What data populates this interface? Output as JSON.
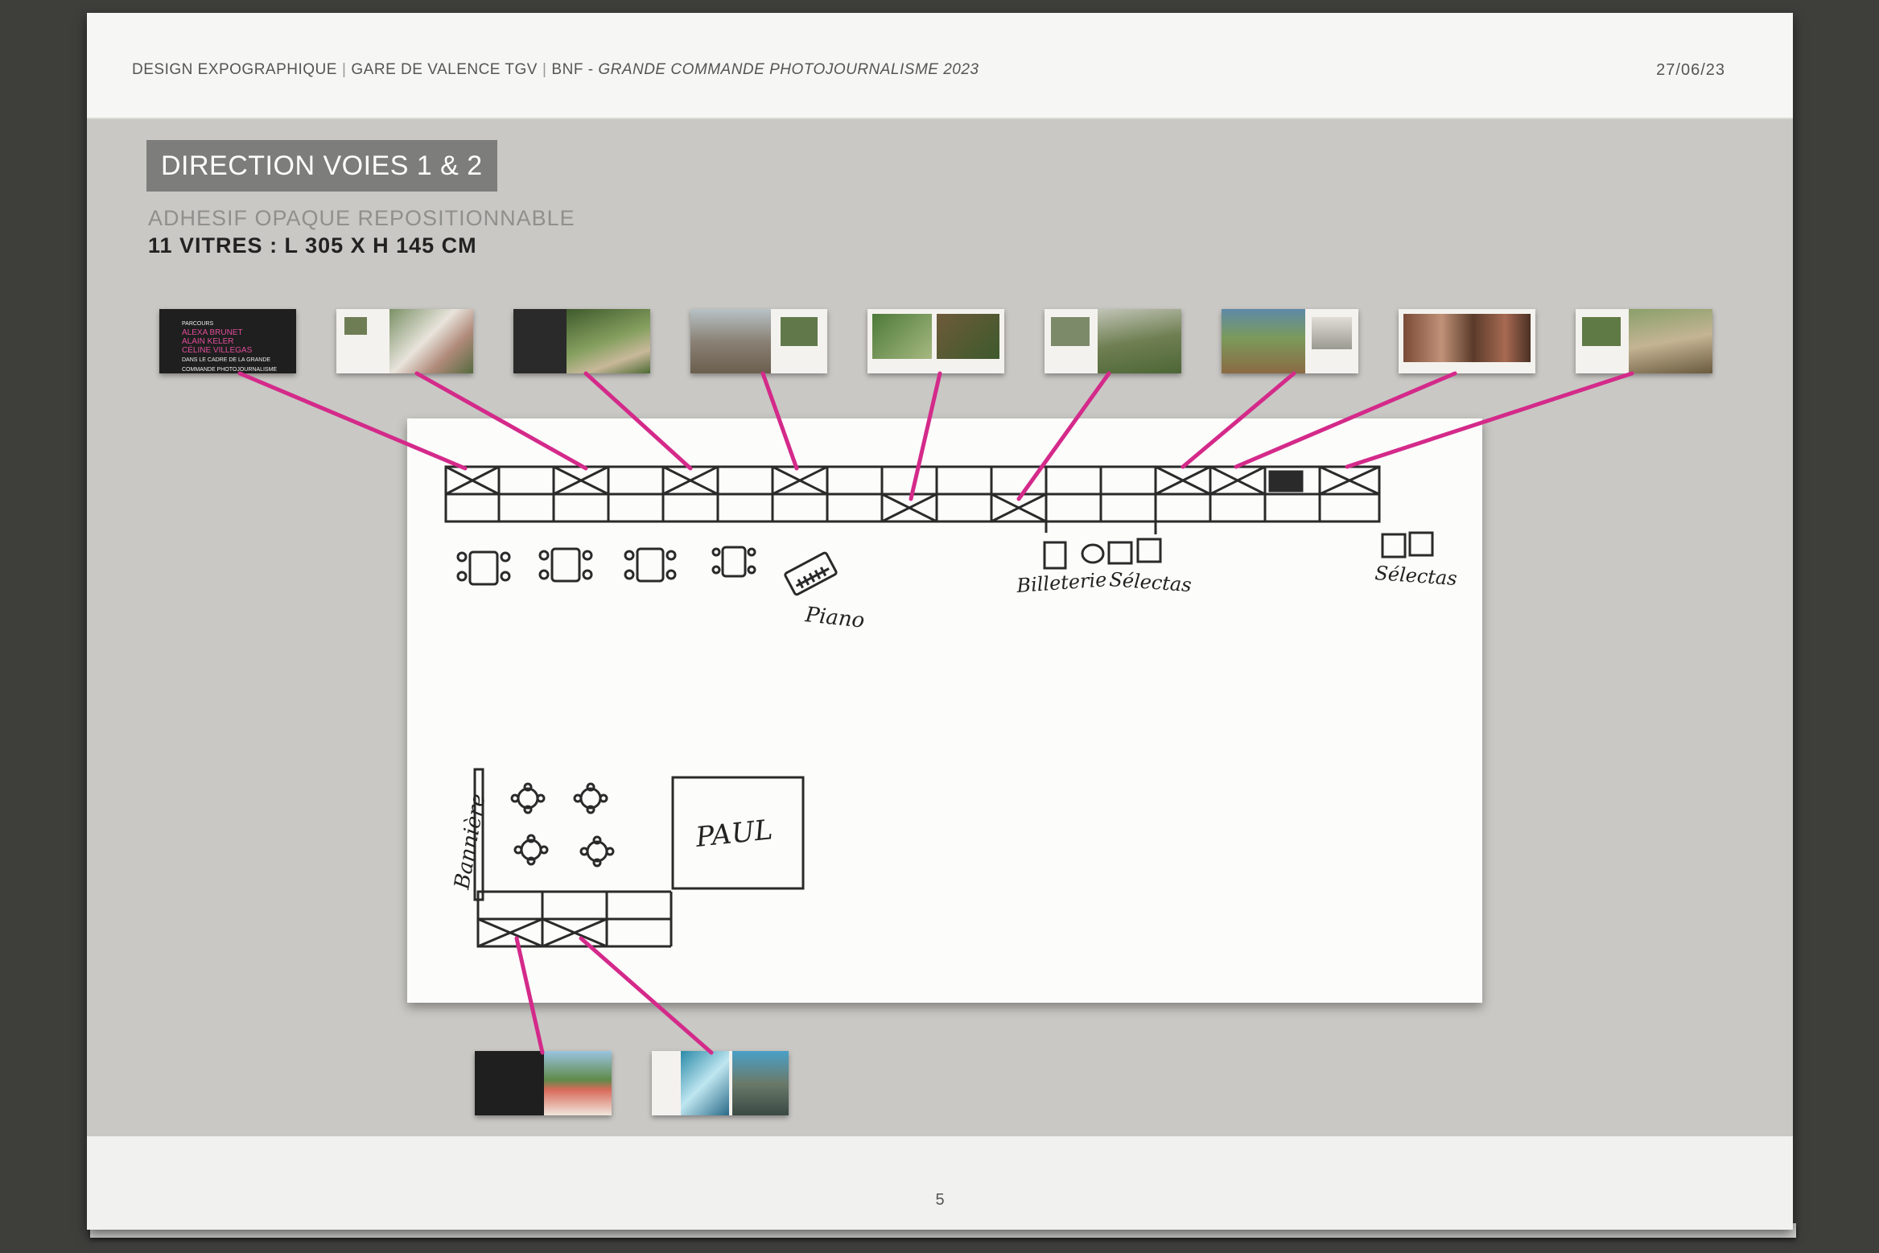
{
  "header": {
    "parts": [
      "DESIGN EXPOGRAPHIQUE",
      "GARE DE VALENCE TGV",
      "BNF - "
    ],
    "italic": "GRANDE COMMANDE PHOTOJOURNALISME 2023",
    "date": "27/06/23"
  },
  "title": "DIRECTION VOIES 1 & 2",
  "subtitle": "ADHESIF OPAQUE REPOSITIONNABLE",
  "dimensions": "11 VITRES : L 305 X H 145 CM",
  "first_thumb_text": {
    "small": "PARCOURS",
    "names": "ALEXA BRUNET\nALAIN KELER\nCÉLINE VILLEGAS",
    "caption": "DANS LE CADRE DE LA GRANDE\nCOMMANDE PHOTOJOURNALISME\nEN PARTENARIAT..."
  },
  "sketch_labels": {
    "piano": "Piano",
    "billetterie": "Billeterie",
    "selectas_1": "Sélectas",
    "selectas_2": "Sélectas",
    "banniere": "Bannière",
    "paul": "PAUL"
  },
  "colors": {
    "accent_line": "#d42a8a",
    "title_box": "#7d7d7b",
    "band": "#c9c8c4"
  },
  "page_number": "5"
}
